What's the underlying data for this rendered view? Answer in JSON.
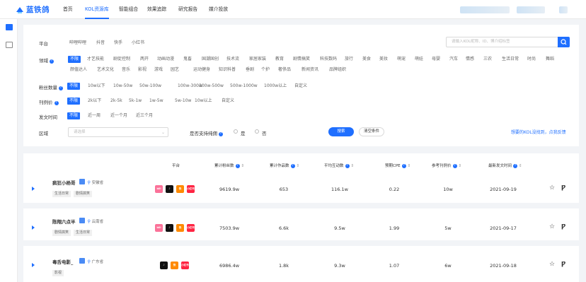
{
  "brand": {
    "name": "蓝铁鸽",
    "color": "#1f6fff"
  },
  "nav": [
    {
      "label": "首页",
      "active": false
    },
    {
      "label": "KOL资源库",
      "active": true
    },
    {
      "label": "智能组合",
      "active": false
    },
    {
      "label": "效果追踪",
      "active": false
    },
    {
      "label": "研究报告",
      "active": false
    },
    {
      "label": "媒介投放",
      "active": false
    }
  ],
  "filters": {
    "platform": {
      "label": "平台",
      "options": [
        "哔哩哔哩",
        "抖音",
        "快手",
        "小红书"
      ]
    },
    "search_placeholder": "请输入KOL昵称、ID、博介绍标签",
    "domain": {
      "label": "领域",
      "options": [
        "不限",
        "才艺技能",
        "剧促控制",
        "两开",
        "动画动漫",
        "鬼畜",
        "国潮国创",
        "技术流",
        "家居家装",
        "教育",
        "剧情搞笑",
        "科技数码",
        "旅行",
        "美食",
        "美妆",
        "萌宠",
        "萌娃",
        "母婴",
        "汽车",
        "情感",
        "三农",
        "生活日常",
        "时尚",
        "舞蹈",
        "颜值达人",
        "艺术文化",
        "音乐",
        "影视",
        "游戏",
        "园艺",
        "运动健身",
        "知识科普",
        "垂剧",
        "个护",
        "奢侈品",
        "新闻资讯",
        "品牌组织"
      ],
      "selected": "不限"
    },
    "fans": {
      "label": "粉丝数量",
      "options": [
        "不限",
        "10w以下",
        "10w-50w",
        "50w-100w",
        "100w-300w",
        "300w-500w",
        "500w-1000w",
        "1000w以上",
        "自定义"
      ],
      "selected": "不限"
    },
    "price": {
      "label": "刊例价",
      "options": [
        "不限",
        "2k以下",
        "2k-5k",
        "5k-1w",
        "1w-5w",
        "5w-10w",
        "10w以上",
        "自定义"
      ],
      "selected": "不限"
    },
    "post_time": {
      "label": "发文时间",
      "options": [
        "不限",
        "近一周",
        "近一个月",
        "近三个月"
      ],
      "selected": "不限"
    },
    "region": {
      "label": "区域",
      "placeholder": "请选择"
    },
    "support": {
      "label": "是否支持纯佣",
      "yes": "是",
      "no": "否"
    },
    "search_button": "搜索",
    "clear_button": "清空条件",
    "feedback": "想要的KOL没找到，点我反馈"
  },
  "table": {
    "headers": [
      {
        "label": "平台",
        "sortable": false
      },
      {
        "label": "累计粉丝数",
        "sortable": true
      },
      {
        "label": "累计作品数",
        "sortable": true
      },
      {
        "label": "平均互动数",
        "sortable": true
      },
      {
        "label": "预期CPE",
        "sortable": true
      },
      {
        "label": "参考刊例价",
        "sortable": true
      },
      {
        "label": "最新发文时间",
        "sortable": true
      }
    ],
    "rows": [
      {
        "name": "疯狂小杨哥",
        "location": "安徽省",
        "tags": [
          "生活日常",
          "剧情搞笑"
        ],
        "platforms": [
          "bilibili",
          "douyin",
          "kuaishou",
          "xiaohongshu"
        ],
        "fans": "9619.9w",
        "works": "653",
        "interact": "116.1w",
        "cpe": "0.22",
        "price": "10w",
        "date": "2021-09-19"
      },
      {
        "name": "陈翔六点半",
        "location": "云南省",
        "tags": [
          "剧情搞笑",
          "生活日常"
        ],
        "platforms": [
          "bilibili",
          "douyin",
          "kuaishou",
          "xiaohongshu"
        ],
        "fans": "7503.9w",
        "works": "6.6k",
        "interact": "9.5w",
        "cpe": "1.99",
        "price": "5w",
        "date": "2021-09-17"
      },
      {
        "name": "毒舌电影_",
        "location": "广东省",
        "tags": [
          "影视"
        ],
        "platforms": [
          "douyin",
          "kuaishou",
          "xiaohongshu"
        ],
        "fans": "6986.4w",
        "works": "1.8k",
        "interact": "9.3w",
        "cpe": "1.07",
        "price": "6w",
        "date": "2021-09-18"
      }
    ]
  }
}
